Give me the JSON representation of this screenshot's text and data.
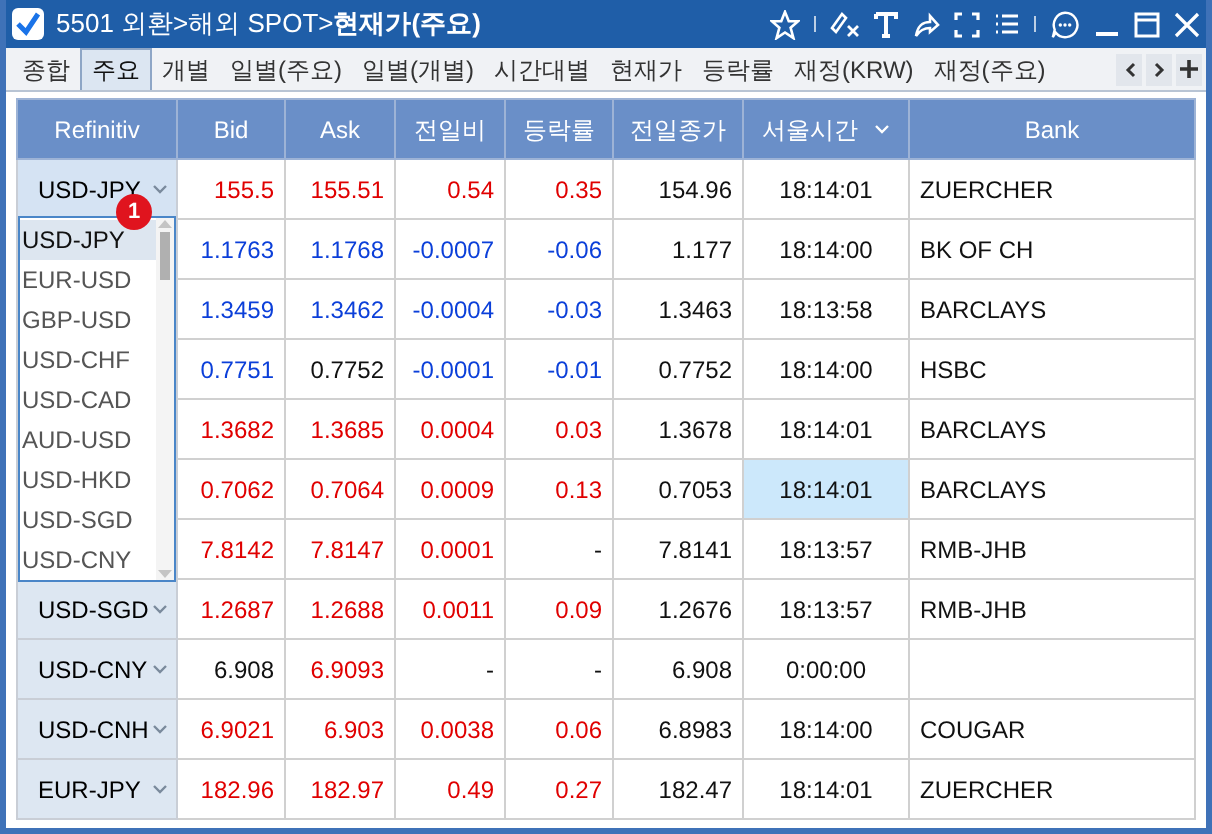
{
  "window": {
    "title": "5501 외환>해외 SPOT>**현재가(주요)**"
  },
  "tabs": [
    {
      "label": "종합",
      "selected": false
    },
    {
      "label": "주요",
      "selected": true
    },
    {
      "label": "개별",
      "selected": false
    },
    {
      "label": "일별(주요)",
      "selected": false
    },
    {
      "label": "일별(개별)",
      "selected": false
    },
    {
      "label": "시간대별",
      "selected": false
    },
    {
      "label": "현재가",
      "selected": false
    },
    {
      "label": "등락률",
      "selected": false
    },
    {
      "label": "재정(KRW)",
      "selected": false
    },
    {
      "label": "재정(주요)",
      "selected": false
    }
  ],
  "table": {
    "columns": [
      {
        "label": "Refinitiv",
        "dropdown": false
      },
      {
        "label": "Bid",
        "dropdown": false
      },
      {
        "label": "Ask",
        "dropdown": false
      },
      {
        "label": "전일비",
        "dropdown": false
      },
      {
        "label": "등락률",
        "dropdown": false
      },
      {
        "label": "전일종가",
        "dropdown": false
      },
      {
        "label": "서울시간",
        "dropdown": true
      },
      {
        "label": "Bank",
        "dropdown": false
      }
    ],
    "rows": [
      {
        "pair": "USD-JPY",
        "bid": {
          "text": "155.5",
          "color": "#e00000"
        },
        "ask": {
          "text": "155.51",
          "color": "#e00000"
        },
        "change": {
          "text": "0.54",
          "color": "#e00000"
        },
        "rate": {
          "text": "0.35",
          "color": "#e00000"
        },
        "prev_close": "154.96",
        "time": "18:14:01",
        "time_highlighted": false,
        "bank": "ZUERCHER"
      },
      {
        "bid": {
          "text": "1.1763",
          "color": "#0b3fd9"
        },
        "ask": {
          "text": "1.1768",
          "color": "#0b3fd9"
        },
        "change": {
          "text": "-0.0007",
          "color": "#0b3fd9"
        },
        "rate": {
          "text": "-0.06",
          "color": "#0b3fd9"
        },
        "prev_close": "1.177",
        "time": "18:14:00",
        "time_highlighted": false,
        "bank": "BK OF CH"
      },
      {
        "bid": {
          "text": "1.3459",
          "color": "#0b3fd9"
        },
        "ask": {
          "text": "1.3462",
          "color": "#0b3fd9"
        },
        "change": {
          "text": "-0.0004",
          "color": "#0b3fd9"
        },
        "rate": {
          "text": "-0.03",
          "color": "#0b3fd9"
        },
        "prev_close": "1.3463",
        "time": "18:13:58",
        "time_highlighted": false,
        "bank": "BARCLAYS"
      },
      {
        "bid": {
          "text": "0.7751",
          "color": "#0b3fd9"
        },
        "ask": {
          "text": "0.7752",
          "color": "#111111"
        },
        "change": {
          "text": "-0.0001",
          "color": "#0b3fd9"
        },
        "rate": {
          "text": "-0.01",
          "color": "#0b3fd9"
        },
        "prev_close": "0.7752",
        "time": "18:14:00",
        "time_highlighted": false,
        "bank": "HSBC"
      },
      {
        "bid": {
          "text": "1.3682",
          "color": "#e00000"
        },
        "ask": {
          "text": "1.3685",
          "color": "#e00000"
        },
        "change": {
          "text": "0.0004",
          "color": "#e00000"
        },
        "rate": {
          "text": "0.03",
          "color": "#e00000"
        },
        "prev_close": "1.3678",
        "time": "18:14:01",
        "time_highlighted": false,
        "bank": "BARCLAYS"
      },
      {
        "bid": {
          "text": "0.7062",
          "color": "#e00000"
        },
        "ask": {
          "text": "0.7064",
          "color": "#e00000"
        },
        "change": {
          "text": "0.0009",
          "color": "#e00000"
        },
        "rate": {
          "text": "0.13",
          "color": "#e00000"
        },
        "prev_close": "0.7053",
        "time": "18:14:01",
        "time_highlighted": true,
        "bank": "BARCLAYS"
      },
      {
        "bid": {
          "text": "7.8142",
          "color": "#e00000"
        },
        "ask": {
          "text": "7.8147",
          "color": "#e00000"
        },
        "change": {
          "text": "0.0001",
          "color": "#e00000"
        },
        "rate": {
          "text": "-",
          "color": "#111111"
        },
        "prev_close": "7.8141",
        "time": "18:13:57",
        "time_highlighted": false,
        "bank": "RMB-JHB"
      },
      {
        "pair": "USD-SGD",
        "bid": {
          "text": "1.2687",
          "color": "#e00000"
        },
        "ask": {
          "text": "1.2688",
          "color": "#e00000"
        },
        "change": {
          "text": "0.0011",
          "color": "#e00000"
        },
        "rate": {
          "text": "0.09",
          "color": "#e00000"
        },
        "prev_close": "1.2676",
        "time": "18:13:57",
        "time_highlighted": false,
        "bank": "RMB-JHB"
      },
      {
        "pair": "USD-CNY",
        "bid": {
          "text": "6.908",
          "color": "#111111"
        },
        "ask": {
          "text": "6.9093",
          "color": "#e00000"
        },
        "change": {
          "text": "-",
          "color": "#111111"
        },
        "rate": {
          "text": "-",
          "color": "#111111"
        },
        "prev_close": "6.908",
        "time": "0:00:00",
        "time_highlighted": false
      },
      {
        "pair": "USD-CNH",
        "bid": {
          "text": "6.9021",
          "color": "#e00000"
        },
        "ask": {
          "text": "6.903",
          "color": "#e00000"
        },
        "change": {
          "text": "0.0038",
          "color": "#e00000"
        },
        "rate": {
          "text": "0.06",
          "color": "#e00000"
        },
        "prev_close": "6.8983",
        "time": "18:14:00",
        "time_highlighted": false,
        "bank": "COUGAR"
      },
      {
        "pair": "EUR-JPY",
        "bid": {
          "text": "182.96",
          "color": "#e00000"
        },
        "ask": {
          "text": "182.97",
          "color": "#e00000"
        },
        "change": {
          "text": "0.49",
          "color": "#e00000"
        },
        "rate": {
          "text": "0.27",
          "color": "#e00000"
        },
        "prev_close": "182.47",
        "time": "18:14:01",
        "time_highlighted": false,
        "bank": "ZUERCHER"
      }
    ]
  },
  "dropdown": {
    "badge": "1",
    "items": [
      {
        "label": "USD-JPY",
        "selected": true
      },
      {
        "label": "EUR-USD",
        "selected": false
      },
      {
        "label": "GBP-USD",
        "selected": false
      },
      {
        "label": "USD-CHF",
        "selected": false
      },
      {
        "label": "USD-CAD",
        "selected": false
      },
      {
        "label": "AUD-USD",
        "selected": false
      },
      {
        "label": "USD-HKD",
        "selected": false
      },
      {
        "label": "USD-SGD",
        "selected": false
      },
      {
        "label": "USD-CNY",
        "selected": false
      }
    ]
  }
}
